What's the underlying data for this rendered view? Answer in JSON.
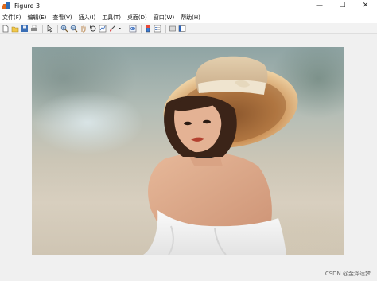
{
  "window": {
    "title": "Figure 3",
    "controls": {
      "minimize": "—",
      "maximize": "☐",
      "close": "✕"
    }
  },
  "menu": {
    "items": [
      "文件(F)",
      "编辑(E)",
      "查看(V)",
      "插入(I)",
      "工具(T)",
      "桌面(D)",
      "窗口(W)",
      "帮助(H)"
    ]
  },
  "toolbar": {
    "icons": [
      "new-figure-icon",
      "open-file-icon",
      "save-icon",
      "print-icon",
      "pointer-icon",
      "zoom-in-icon",
      "zoom-out-icon",
      "pan-icon",
      "rotate-3d-icon",
      "data-cursor-icon",
      "brush-icon",
      "link-plot-icon",
      "colorbar-icon",
      "legend-icon",
      "hide-plot-tools-icon",
      "show-plot-tools-icon"
    ]
  },
  "figure": {
    "image": "portrait-photo"
  },
  "watermark": "CSDN @金泽适梦"
}
